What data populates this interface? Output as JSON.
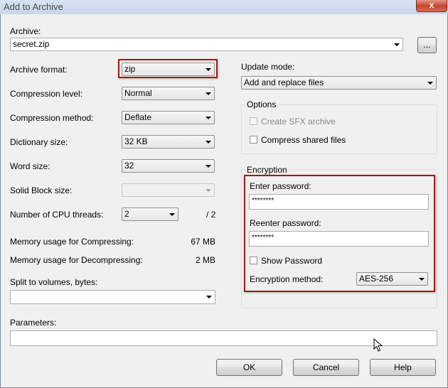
{
  "window": {
    "title": "Add to Archive",
    "close_glyph": "x"
  },
  "archive": {
    "label": "Archive:",
    "value": "secret.zip",
    "browse_label": "..."
  },
  "left": {
    "format": {
      "label": "Archive format:",
      "value": "zip"
    },
    "level": {
      "label": "Compression level:",
      "value": "Normal"
    },
    "method": {
      "label": "Compression method:",
      "value": "Deflate"
    },
    "dictionary": {
      "label": "Dictionary size:",
      "value": "32 KB"
    },
    "word": {
      "label": "Word size:",
      "value": "32"
    },
    "solid": {
      "label": "Solid Block size:",
      "value": ""
    },
    "threads": {
      "label": "Number of CPU threads:",
      "value": "2",
      "max": "/ 2"
    },
    "mem_compress": {
      "label": "Memory usage for Compressing:",
      "value": "67 MB"
    },
    "mem_decompress": {
      "label": "Memory usage for Decompressing:",
      "value": "2 MB"
    },
    "split": {
      "label": "Split to volumes, bytes:",
      "value": ""
    },
    "parameters": {
      "label": "Parameters:",
      "value": ""
    }
  },
  "right": {
    "update": {
      "label": "Update mode:",
      "value": "Add and replace files"
    },
    "options": {
      "legend": "Options",
      "sfx": {
        "label": "Create SFX archive",
        "checked": false,
        "enabled": false
      },
      "shared": {
        "label": "Compress shared files",
        "checked": false,
        "enabled": true
      }
    },
    "encryption": {
      "legend": "Encryption",
      "enter_label": "Enter password:",
      "enter_value": "********",
      "reenter_label": "Reenter password:",
      "reenter_value": "********",
      "show_label": "Show Password",
      "show_checked": false,
      "method_label": "Encryption method:",
      "method_value": "AES-256"
    }
  },
  "buttons": {
    "ok": "OK",
    "cancel": "Cancel",
    "help": "Help"
  },
  "colors": {
    "highlight": "#a01818",
    "titlebar": "#c6d6ea",
    "close": "#c8452c"
  }
}
